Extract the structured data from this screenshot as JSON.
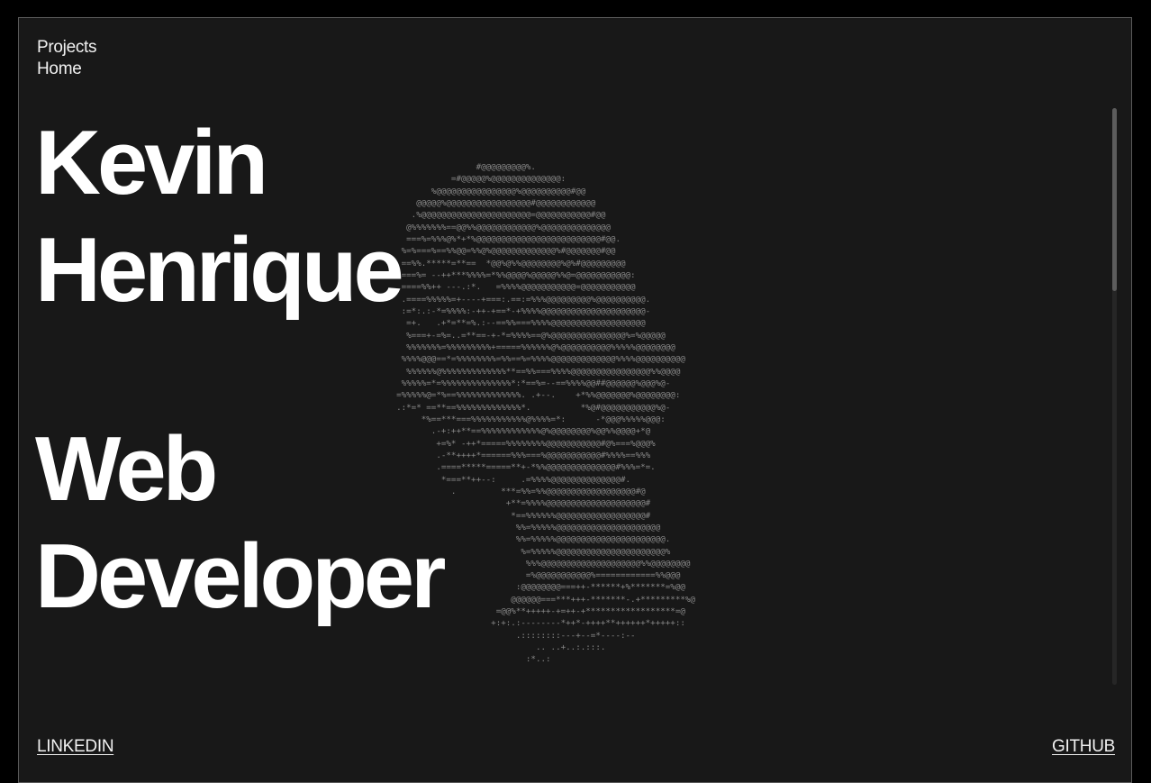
{
  "nav": {
    "items": [
      {
        "label": "Projects"
      },
      {
        "label": "Home"
      }
    ]
  },
  "hero": {
    "name_line1": "Kevin",
    "name_line2": "Henrique",
    "role_line1": "Web",
    "role_line2": "Developer"
  },
  "portrait": {
    "icon": "ascii-art-head-portrait",
    "ascii": "                  #@@@@@@@@@%.\n             =#@@@@@%@@@@@@@@@@@@@@:\n         %@@@@@@@@@@@@@@@@%@@@@@@@@@@#@@\n      @@@@@%@@@@@@@@@@@@@@@@@#@@@@@@@@@@@@\n     .%@@@@@@@@@@@@@@@@@@@@@@=@@@@@@@@@@@#@@\n    @%%%%%%%==@@%%@@@@@@@@@@@@%@@@@@@@@@@@@@@\n    ===%=%%%@%*+*%@@@@@@@@@@@@@@@@@@@@@@@@@#@@.\n   %=%===%==%%@@=%%@%@@@@@@@@@@@@@%#@@@@@@@#@@\n   ==%%.*****=**==  *@@%@%%@@@@@@@@%@%#@@@@@@@@@\n   ===%= --++***%%%%=*%%@@@@%@@@@@%%@=@@@@@@@@@@@:\n   ====%%++ ---.:*.   =%%%%@@@@@@@@@@@=@@@@@@@@@@@\n   .====%%%%%=+----+===:.==:=%%%@@@@@@@@@%@@@@@@@@@@.\n   :=*:.:-*=%%%%:-++-+==*-+%%%%@@@@@@@@@@@@@@@@@@@@@-\n    =+.   .+*=**=%.:--==%%===%%%%@@@@@@@@@@@@@@@@@@@\n    %===+-=%=..=**==-+-*=%%%%==@%@@@@@@@@@@@@@@@%=%@@@@@\n    %%%%%%%=%%%%%%%%%+=====%%%%%%@%@@@@@@@@@@%%%%%@@@@@@@@\n   %%%%@@@==*=%%%%%%%%=%%==%=%%%%@@@@@@@@@@@@@%%%%@@@@@@@@@@\n    %%%%%%@%%%%%%%%%%%%%**==%%===%%%%@@@@@@@@@@@@@@@@%%@@@@\n   %%%%%=*=%%%%%%%%%%%%%%*:*==%=--==%%%%@@##@@@@@@%@@@%@-\n  =%%%%%@=*%==%%%%%%%%%%%%%. .+--.    +*%%@@@@@@@%@@@@@@@@:\n  .:*=* ==**==%%%%%%%%%%%%%*.          *%@#@@@@@@@@@@@%@-\n       *%==***===%%%%%%%%%%%@%%%%=*:      -*@@@%%%%%@@@:\n         .-+:++**==%%%%%%%%%%%%@%@@@@@@@@%@@%%@@@@+*@\n          +=%* -++*=====%%%%%%%%@@@@@@@@@@@#@%===%@@@%\n          .-**++++*======%%%===%@@@@@@@@@@@#%%%%==%%%\n          .====*****=====**+-*%%@@@@@@@@@@@@@@#%%%=*=.\n           *===**++--:     .=%%%%@@@@@@@@@@@@@@#.\n             .         ***=%%=%%@@@@@@@@@@@@@@@@@@#@\n                        +**=%%%%@@@@@@@@@@@@@@@@@@@@#\n                         *==%%%%%%@@@@@@@@@@@@@@@@@@#\n                          %%=%%%%%@@@@@@@@@@@@@@@@@@@@@\n                          %%=%%%%%@@@@@@@@@@@@@@@@@@@@@@.\n                           %=%%%%%@@@@@@@@@@@@@@@@@@@@@@%\n                            %%%@@@@@@@@@@@@@@@@@@@@%%@@@@@@@@\n                            =%@@@@@@@@@@@%============%%@@@\n                          :@@@@@@@@===++-******+%*******=%@@\n                         @@@@@@===***+++-*******-.+*********%@\n                      =@@%**+++++-+=++-+******************=@\n                     +:+:.:--------*++*-++++**++++++*+++++::\n                          .::::::::---+--=*----:--\n                              .. ..+..:.:::.\n                            :*..:"
  },
  "footer": {
    "left_link": "LINKEDIN",
    "right_link": "GITHUB"
  },
  "colors": {
    "page_background": "#000000",
    "panel_background": "#181818",
    "text": "#ffffff",
    "ascii": "#8a8a8a"
  }
}
